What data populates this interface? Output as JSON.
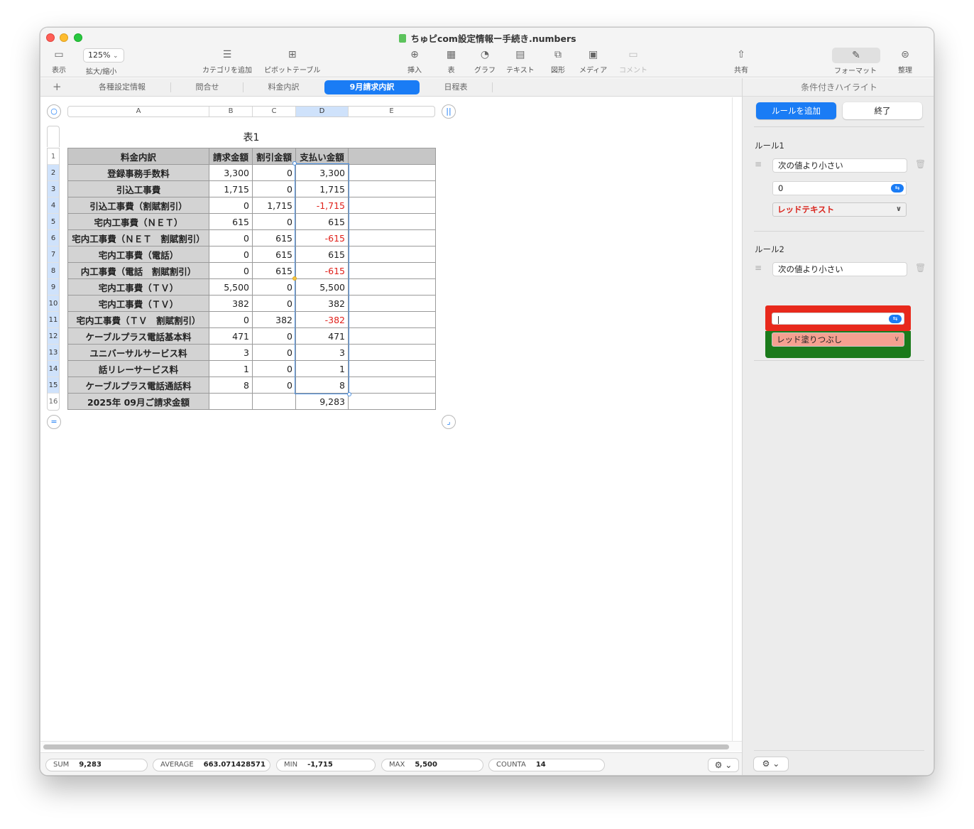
{
  "window": {
    "title": "ちゅピcom設定情報ー手続き.numbers"
  },
  "toolbar": {
    "view_label": "表示",
    "zoom_value": "125%",
    "zoom_label": "拡大/縮小",
    "add_category_label": "カテゴリを追加",
    "pivot_label": "ピボットテーブル",
    "insert_label": "挿入",
    "table_label": "表",
    "chart_label": "グラフ",
    "text_label": "テキスト",
    "shape_label": "図形",
    "media_label": "メディア",
    "comment_label": "コメント",
    "share_label": "共有",
    "format_label": "フォーマット",
    "organize_label": "整理"
  },
  "sheets": {
    "tabs": [
      "各種設定情報",
      "問合せ",
      "料金内訳",
      "9月請求内訳",
      "日程表"
    ],
    "active": "9月請求内訳"
  },
  "table": {
    "title": "表1",
    "columns": [
      "A",
      "B",
      "C",
      "D",
      "E"
    ],
    "selected_column": "D",
    "row_numbers": [
      "1",
      "2",
      "3",
      "4",
      "5",
      "6",
      "7",
      "8",
      "9",
      "10",
      "11",
      "12",
      "13",
      "14",
      "15",
      "16"
    ],
    "header": [
      "料金内訳",
      "請求金額",
      "割引金額",
      "支払い金額",
      ""
    ],
    "rows": [
      [
        "登録事務手数料",
        "3,300",
        "0",
        "3,300",
        ""
      ],
      [
        "引込工事費",
        "1,715",
        "0",
        "1,715",
        ""
      ],
      [
        "引込工事費（割賦割引）",
        "0",
        "1,715",
        "-1,715",
        ""
      ],
      [
        "宅内工事費（ＮＥＴ）",
        "615",
        "0",
        "615",
        ""
      ],
      [
        "宅内工事費（ＮＥＴ　割賦割引）",
        "0",
        "615",
        "-615",
        ""
      ],
      [
        "宅内工事費（電話）",
        "0",
        "615",
        "615",
        ""
      ],
      [
        "内工事費（電話　割賦割引）",
        "0",
        "615",
        "-615",
        ""
      ],
      [
        "宅内工事費（ＴＶ）",
        "5,500",
        "0",
        "5,500",
        ""
      ],
      [
        "宅内工事費（ＴＶ）",
        "382",
        "0",
        "382",
        ""
      ],
      [
        "宅内工事費（ＴＶ　割賦割引）",
        "0",
        "382",
        "-382",
        ""
      ],
      [
        "ケーブルプラス電話基本料",
        "471",
        "0",
        "471",
        ""
      ],
      [
        "ユニバーサルサービス料",
        "3",
        "0",
        "3",
        ""
      ],
      [
        "話リレーサービス料",
        "1",
        "0",
        "1",
        ""
      ],
      [
        "ケーブルプラス電話通話料",
        "8",
        "0",
        "8",
        ""
      ],
      [
        "2025年 09月ご請求金額",
        "",
        "",
        "9,283",
        ""
      ]
    ],
    "negative_color": "#e0201a"
  },
  "statusbar": {
    "sum_label": "SUM",
    "sum_value": "9,283",
    "average_label": "AVERAGE",
    "average_value": "663.071428571",
    "min_label": "MIN",
    "min_value": "-1,715",
    "max_label": "MAX",
    "max_value": "5,500",
    "counta_label": "COUNTA",
    "counta_value": "14"
  },
  "sidebar": {
    "title": "条件付きハイライト",
    "add_rule": "ルールを追加",
    "done": "終了",
    "rule1": {
      "title": "ルール1",
      "condition": "次の値より小さい",
      "value": "0",
      "style": "レッドテキスト"
    },
    "rule2": {
      "title": "ルール2",
      "condition": "次の値より小さい",
      "value": "",
      "style": "レッド塗りつぶし"
    }
  },
  "colors": {
    "accent": "#1a7cf5",
    "highlight_red": "#e8291c",
    "highlight_green": "#1b7a1b",
    "red_fill": "#f5a091"
  }
}
